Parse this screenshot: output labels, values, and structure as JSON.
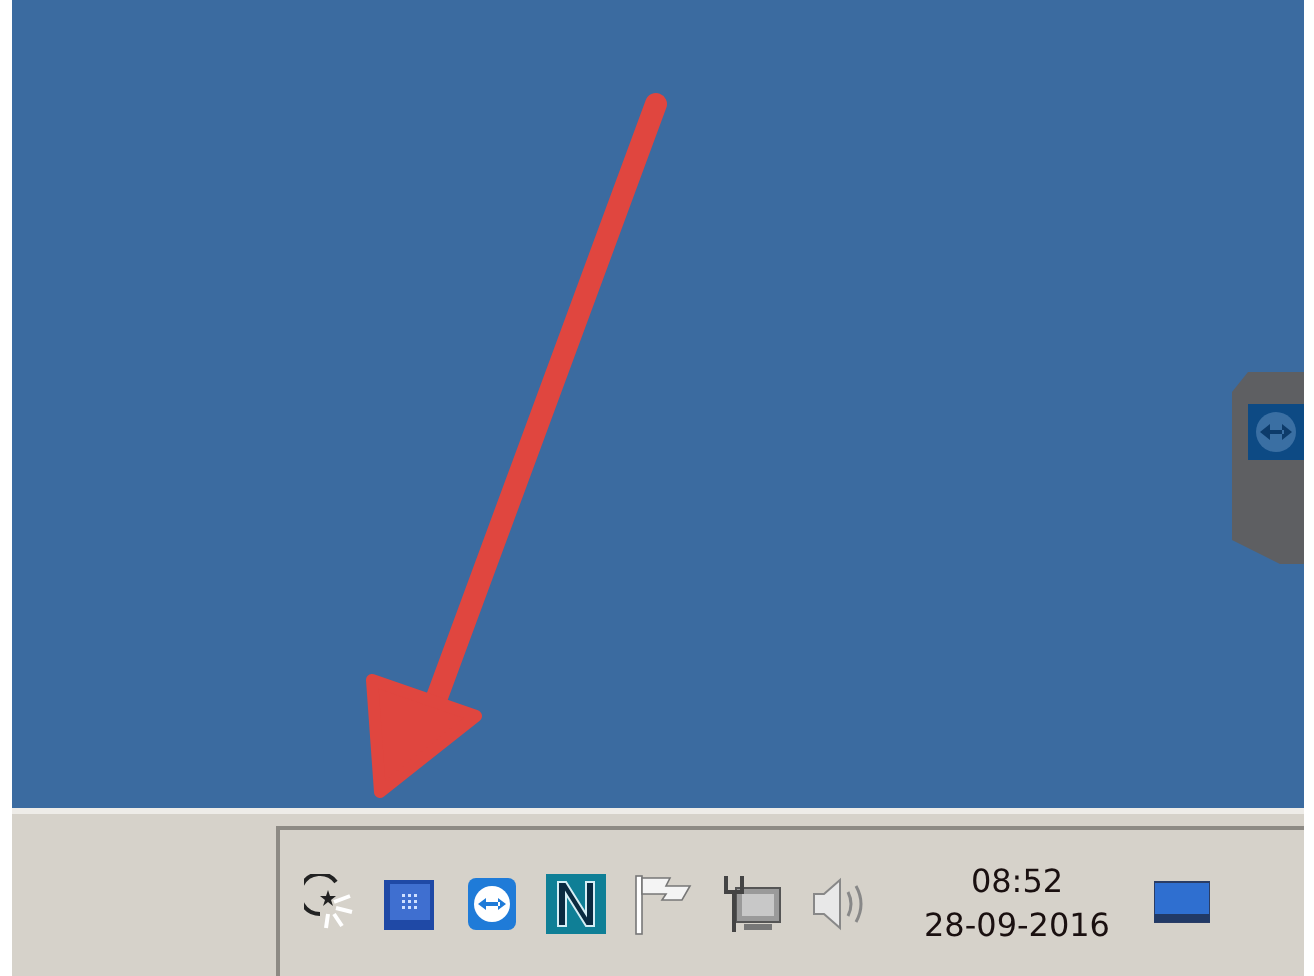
{
  "tray": {
    "clock": {
      "time": "08:52",
      "date": "28-09-2016"
    }
  }
}
